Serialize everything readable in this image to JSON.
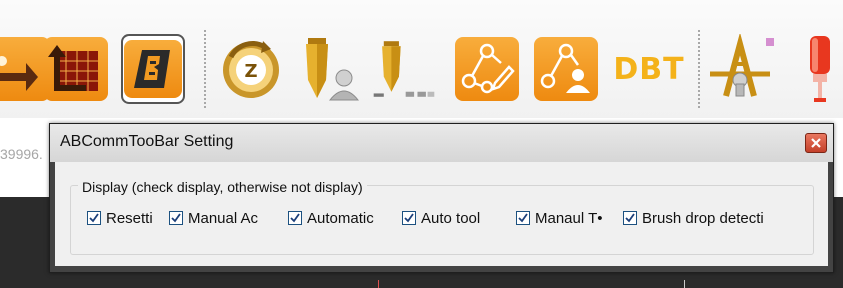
{
  "toolbar": {
    "dbt_label": "DBT",
    "buttons": [
      {
        "icon": "toolpath-icon"
      },
      {
        "icon": "grid-arrow-icon"
      },
      {
        "icon": "b-icon"
      },
      {
        "icon": "z-return-icon"
      },
      {
        "icon": "pen-user-icon"
      },
      {
        "icon": "pen-level-icon"
      },
      {
        "icon": "network-edit-icon"
      },
      {
        "icon": "network-user-icon"
      },
      {
        "icon": "dbt-icon"
      },
      {
        "icon": "height-touch-icon"
      },
      {
        "icon": "light-tower-icon"
      }
    ]
  },
  "status_text": "39996.",
  "dialog": {
    "title": "ABCommTooBar Setting",
    "group_label": "Display (check display, otherwise not display)",
    "checkboxes": [
      {
        "label": "Resetti",
        "checked": true
      },
      {
        "label": "Manual Ac",
        "checked": true
      },
      {
        "label": "Automatic",
        "checked": true
      },
      {
        "label": "Auto tool",
        "checked": true
      },
      {
        "label": "Manaul T•",
        "checked": true
      },
      {
        "label": "Brush drop detecti",
        "checked": true
      }
    ]
  },
  "colors": {
    "orange": "#ee8a10",
    "gold": "#f4b21a",
    "close_red": "#c4402a",
    "dark_background": "#2b2b2b"
  }
}
